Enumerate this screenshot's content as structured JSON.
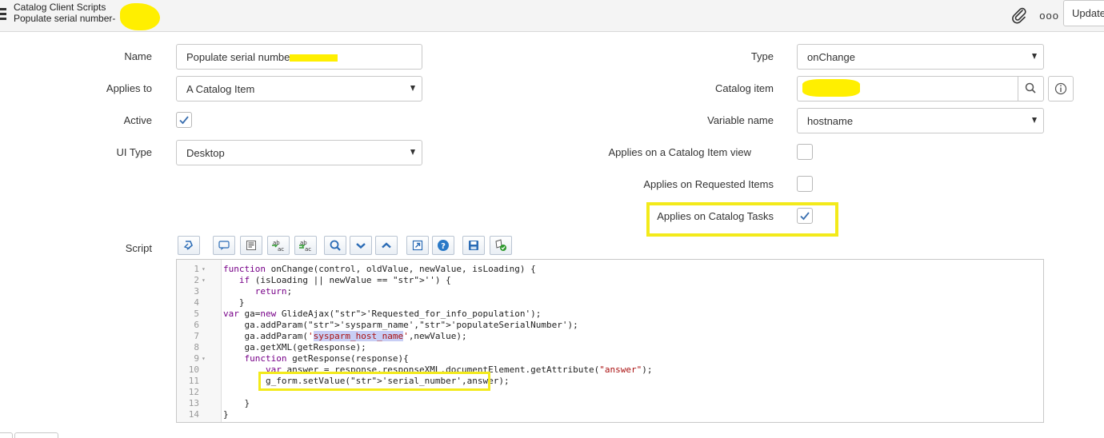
{
  "header": {
    "title": "Catalog Client Scripts",
    "subtitle": "Populate serial number-",
    "update_label": "Update",
    "more_label": "ooo"
  },
  "form": {
    "name_label": "Name",
    "name_value": "Populate serial numbe",
    "applies_to_label": "Applies to",
    "applies_to_value": "A Catalog Item",
    "active_label": "Active",
    "ui_type_label": "UI Type",
    "ui_type_value": "Desktop",
    "type_label": "Type",
    "type_value": "onChange",
    "catalog_item_label": "Catalog item",
    "variable_name_label": "Variable name",
    "variable_name_value": "hostname",
    "applies_catalog_item_view_label": "Applies on a Catalog Item view",
    "applies_requested_items_label": "Applies on Requested Items",
    "applies_catalog_tasks_label": "Applies on Catalog Tasks",
    "script_label": "Script"
  },
  "checkboxes": {
    "active": true,
    "applies_catalog_item_view": false,
    "applies_requested_items": false,
    "applies_catalog_tasks": true
  },
  "toolbar_icons": [
    "format-icon",
    "comment-icon",
    "format-code-icon",
    "replace-icon",
    "replace-all-icon",
    "search-icon",
    "fold-icon",
    "unfold-icon",
    "fullscreen-icon",
    "help-icon",
    "save-icon",
    "script-debug-icon"
  ],
  "code_lines": [
    {
      "n": "1",
      "fold": true
    },
    {
      "n": "2",
      "fold": true
    },
    {
      "n": "3",
      "fold": false
    },
    {
      "n": "4",
      "fold": false
    },
    {
      "n": "5",
      "fold": false
    },
    {
      "n": "6",
      "fold": false
    },
    {
      "n": "7",
      "fold": false
    },
    {
      "n": "8",
      "fold": false
    },
    {
      "n": "9",
      "fold": true
    },
    {
      "n": "10",
      "fold": false
    },
    {
      "n": "11",
      "fold": false
    },
    {
      "n": "12",
      "fold": false
    },
    {
      "n": "13",
      "fold": false
    },
    {
      "n": "14",
      "fold": false
    }
  ],
  "code": {
    "l1": "function onChange(control, oldValue, newValue, isLoading) {",
    "l2": "   if (isLoading || newValue == '') {",
    "l3": "      return;",
    "l4": "   }",
    "l5": "var ga=new GlideAjax('Requested_for_info_population');",
    "l6": "    ga.addParam('sysparm_name','populateSerialNumber');",
    "l7a": "    ga.addParam('",
    "l7b": "sysparm_host_name",
    "l7c": "',newValue);",
    "l8": "    ga.getXML(getResponse);",
    "l9": "    function getResponse(response){",
    "l10": "        var answer = response.responseXML.documentElement.getAttribute(\"answer\");",
    "l11": "        g_form.setValue('serial_number',answer);",
    "l12": "",
    "l13": "    }",
    "l14": "}"
  },
  "colors": {
    "highlight_box": "#f3ea1a",
    "redaction": "#ffef00",
    "checkbox_check": "#3a6fb0"
  }
}
